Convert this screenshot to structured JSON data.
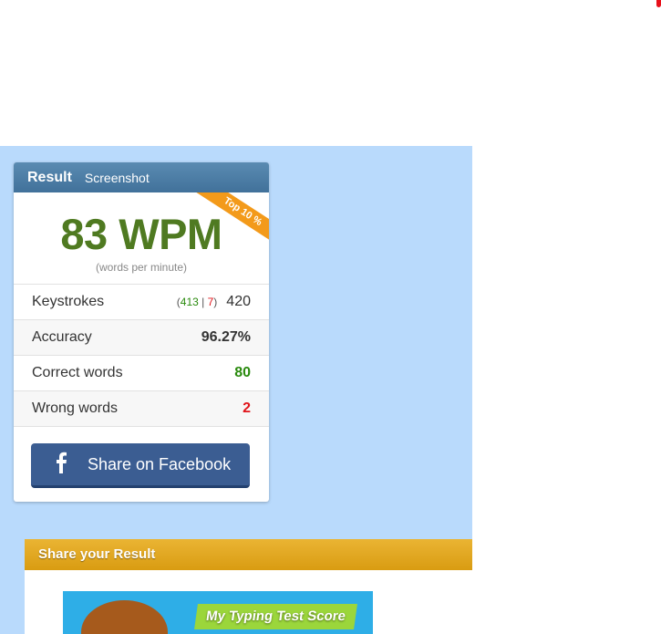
{
  "result_card": {
    "tabs": {
      "result": "Result",
      "screenshot": "Screenshot"
    },
    "wpm": "83 WPM",
    "wpm_unit": "(words per minute)",
    "badge": "Top 10 %",
    "stats": {
      "keystrokes": {
        "label": "Keystrokes",
        "correct": "413",
        "separator": "|",
        "wrong": "7",
        "open": "(",
        "close": ")",
        "total": "420"
      },
      "accuracy": {
        "label": "Accuracy",
        "value": "96.27%"
      },
      "correct_words": {
        "label": "Correct words",
        "value": "80"
      },
      "wrong_words": {
        "label": "Wrong words",
        "value": "2"
      }
    },
    "share_button": {
      "label": "Share on Facebook",
      "icon": "facebook-icon"
    }
  },
  "share_panel": {
    "title": "Share your Result",
    "image_banner": "My Typing Test Score"
  },
  "colors": {
    "background_blue": "#b9dafc",
    "header_blue": "#41719a",
    "wpm_green": "#4f7a21",
    "badge_orange": "#f39a1a",
    "facebook_blue": "#3b5d92",
    "share_header_gold": "#d99c12",
    "correct_green": "#2a8a0e",
    "wrong_red": "#e0141a"
  }
}
